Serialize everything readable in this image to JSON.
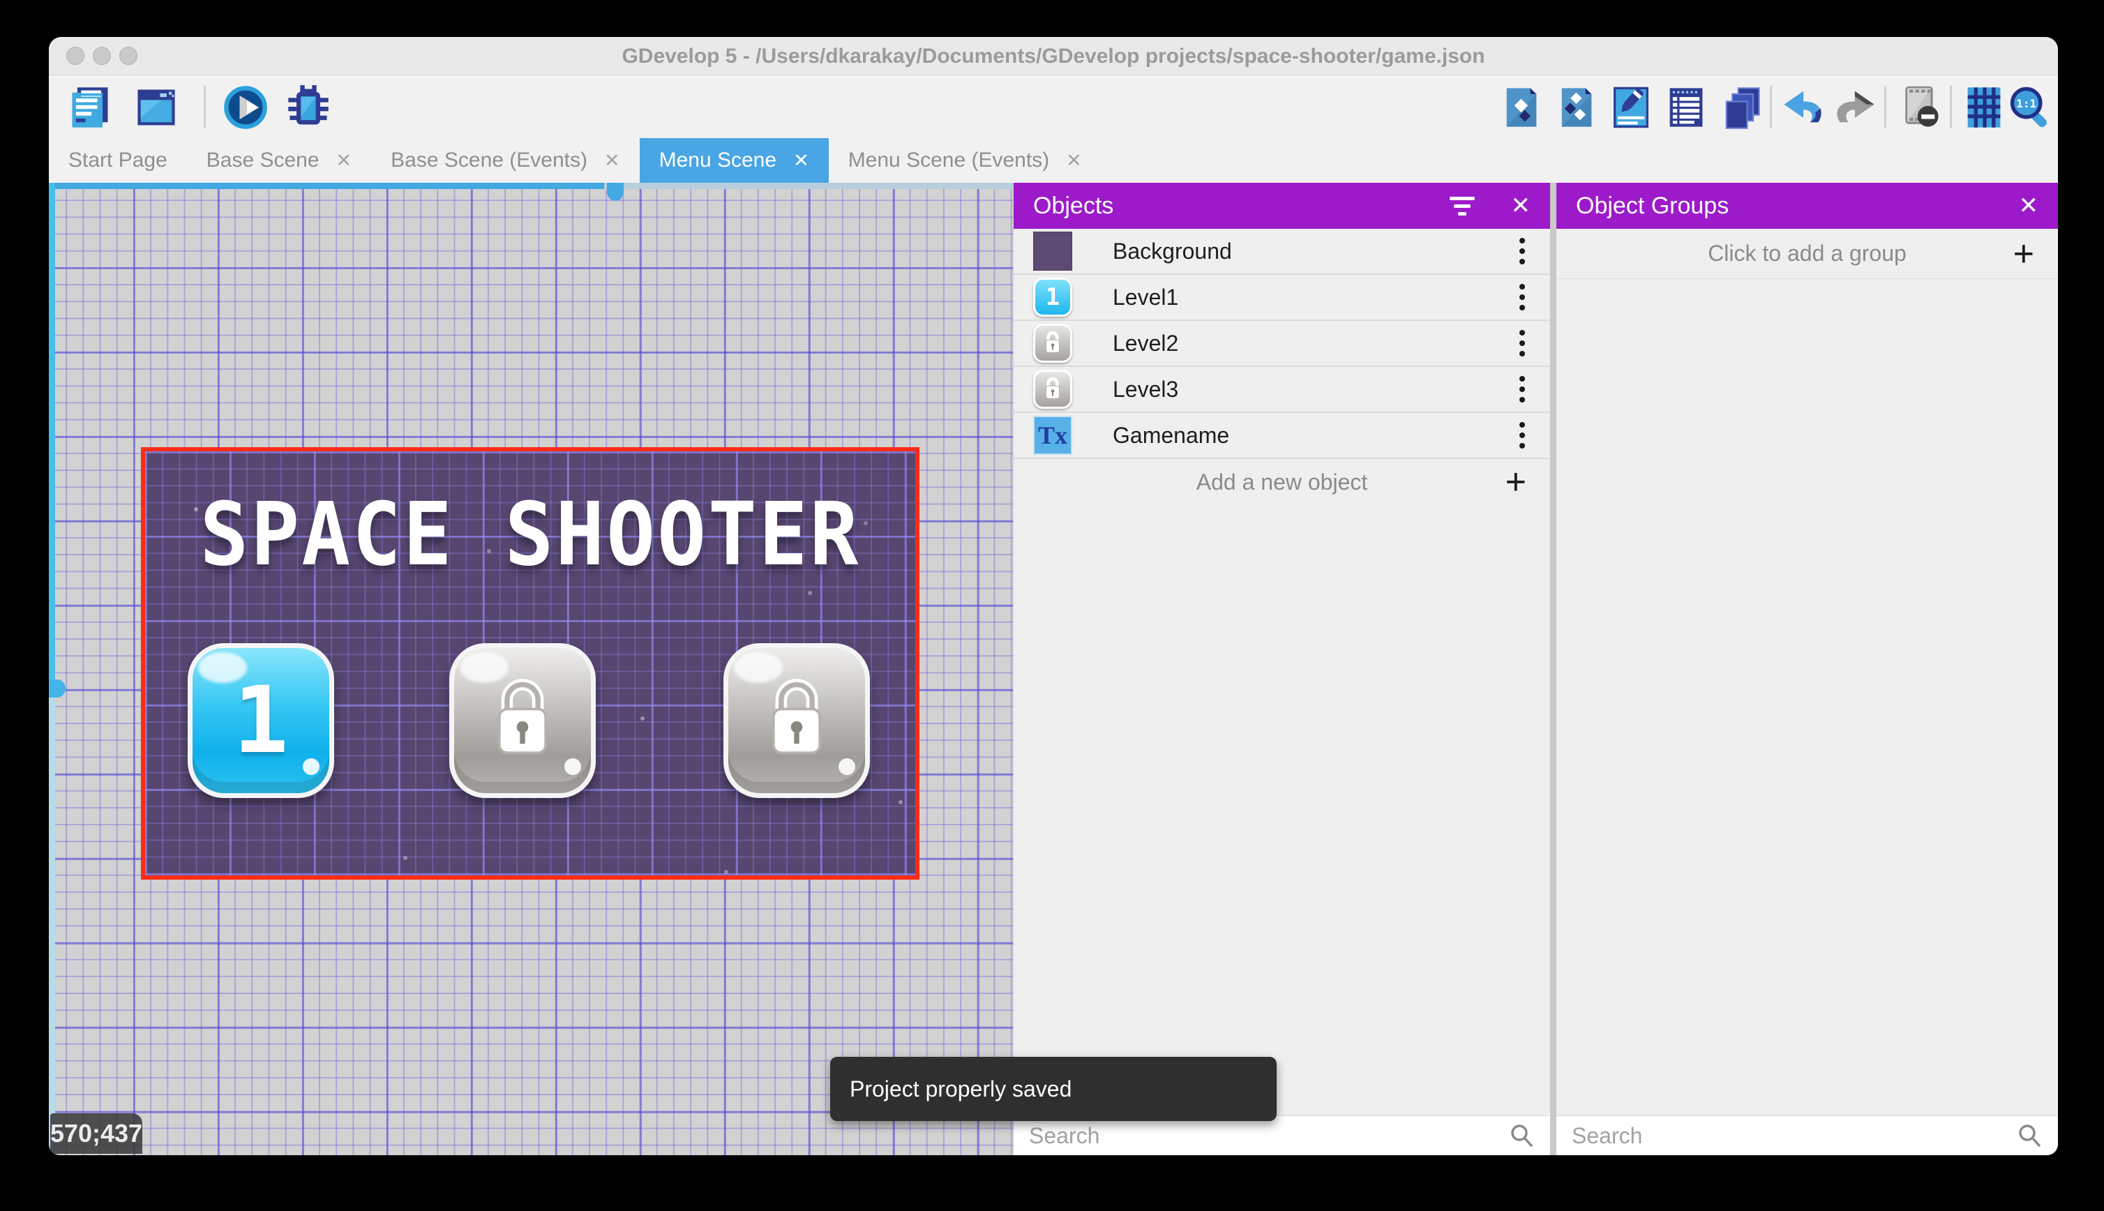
{
  "window": {
    "title": "GDevelop 5 - /Users/dkarakay/Documents/GDevelop projects/space-shooter/game.json"
  },
  "toolbar": {
    "left_icons": [
      "project-manager-icon",
      "scene-window-icon",
      "preview-icon",
      "debug-preview-icon"
    ],
    "right_icons": [
      "objects-editor-icon",
      "object-groups-icon",
      "properties-icon",
      "instances-list-icon",
      "layers-icon",
      "undo-icon",
      "redo-icon",
      "window-mask-icon",
      "grid-icon",
      "zoom-ratio-icon"
    ]
  },
  "tabs": {
    "items": [
      {
        "label": "Start Page",
        "closable": false,
        "active": false
      },
      {
        "label": "Base Scene",
        "closable": true,
        "active": false
      },
      {
        "label": "Base Scene (Events)",
        "closable": true,
        "active": false
      },
      {
        "label": "Menu Scene",
        "closable": true,
        "active": true
      },
      {
        "label": "Menu Scene (Events)",
        "closable": true,
        "active": false
      }
    ]
  },
  "canvas": {
    "scene_title": "SPACE SHOOTER",
    "level1_label": "1",
    "coordinates": "570;437",
    "toast": "Project properly saved"
  },
  "objects_panel": {
    "title": "Objects",
    "items": [
      {
        "name": "Background",
        "thumb": "purple-square"
      },
      {
        "name": "Level1",
        "thumb": "blue-button-1",
        "thumb_label": "1"
      },
      {
        "name": "Level2",
        "thumb": "gray-lock-button"
      },
      {
        "name": "Level3",
        "thumb": "gray-lock-button"
      },
      {
        "name": "Gamename",
        "thumb": "text-object",
        "thumb_label": "Tx"
      }
    ],
    "add_label": "Add a new object",
    "search_placeholder": "Search"
  },
  "groups_panel": {
    "title": "Object Groups",
    "empty_label": "Click to add a group",
    "search_placeholder": "Search"
  },
  "glyphs": {
    "close": "✕",
    "plus": "+",
    "zoom_ratio": "1:1"
  },
  "colors": {
    "panel_header_purple": "#9c1ac9",
    "active_tab_blue": "#49a5e3",
    "scene_border_red": "#fb2c15",
    "scene_background": "#564670",
    "canvas_background": "#d2d2d2",
    "toast_background": "#2f2f2f"
  }
}
